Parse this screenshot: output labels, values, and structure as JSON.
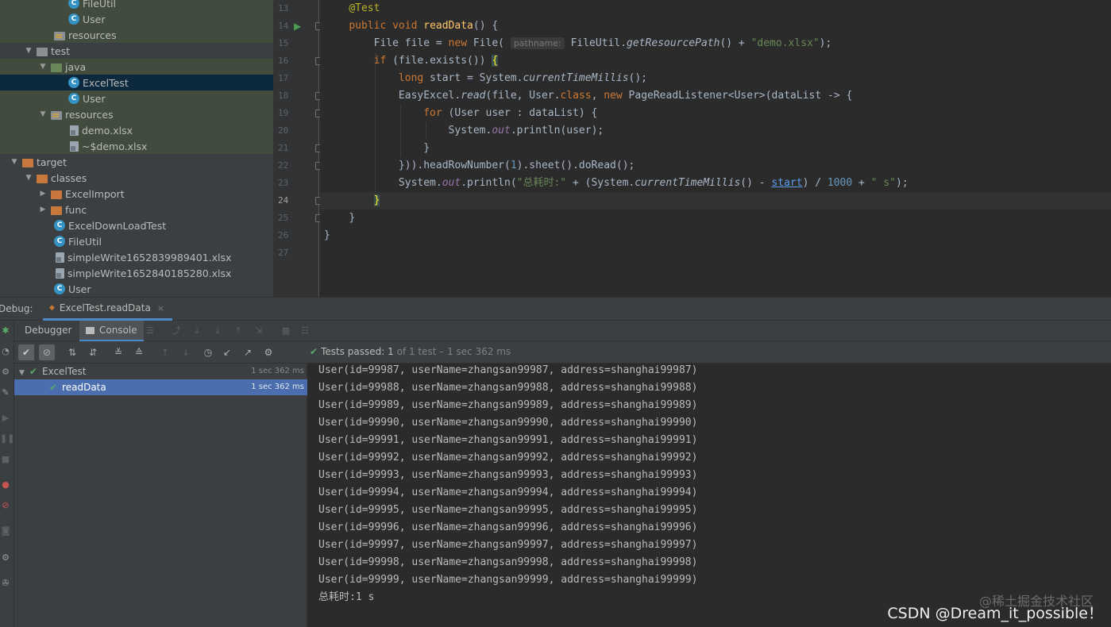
{
  "project_tree": {
    "items": [
      {
        "label": "FileUtil",
        "icon": "class-icon"
      },
      {
        "label": "User",
        "icon": "class-icon"
      },
      {
        "label": "resources",
        "icon": "resources-folder-icon"
      },
      {
        "label": "test",
        "icon": "folder-icon"
      },
      {
        "label": "java",
        "icon": "source-folder-icon"
      },
      {
        "label": "ExcelTest",
        "icon": "class-icon"
      },
      {
        "label": "User",
        "icon": "class-icon"
      },
      {
        "label": "resources",
        "icon": "resources-folder-icon"
      },
      {
        "label": "demo.xlsx",
        "icon": "file-icon"
      },
      {
        "label": "~$demo.xlsx",
        "icon": "file-icon"
      },
      {
        "label": "target",
        "icon": "folder-icon"
      },
      {
        "label": "classes",
        "icon": "folder-icon"
      },
      {
        "label": "ExcelImport",
        "icon": "folder-icon"
      },
      {
        "label": "func",
        "icon": "folder-icon"
      },
      {
        "label": "ExcelDownLoadTest",
        "icon": "class-icon"
      },
      {
        "label": "FileUtil",
        "icon": "class-icon"
      },
      {
        "label": "simpleWrite1652839989401.xlsx",
        "icon": "file-icon"
      },
      {
        "label": "simpleWrite1652840185280.xlsx",
        "icon": "file-icon"
      },
      {
        "label": "User",
        "icon": "class-icon"
      }
    ]
  },
  "editor": {
    "line_numbers": [
      "13",
      "14",
      "15",
      "16",
      "17",
      "18",
      "19",
      "20",
      "21",
      "22",
      "23",
      "24",
      "25",
      "26",
      "27"
    ],
    "current_line": "24",
    "param_hint": "pathname:",
    "code": {
      "l13_ann": "@Test",
      "l14_kw1": "public",
      "l14_kw2": "void",
      "l14_fn": "readData",
      "l14_rest": "() {",
      "l15_a": "File file = ",
      "l15_kw": "new",
      "l15_b": " File(",
      "l15_c": "FileUtil.",
      "l15_it": "getResourcePath",
      "l15_d": "() + ",
      "l15_str": "\"demo.xlsx\"",
      "l15_e": ");",
      "l16_kw": "if",
      "l16_a": " (file.exists()) ",
      "l16_brace": "{",
      "l17_kw": "long",
      "l17_a": " start = System.",
      "l17_it": "currentTimeMillis",
      "l17_b": "();",
      "l18_a": "EasyExcel.",
      "l18_it": "read",
      "l18_b": "(file, User.",
      "l18_kw1": "class",
      "l18_c": ", ",
      "l18_kw2": "new",
      "l18_d": " PageReadListener<User>(dataList -> {",
      "l19_kw": "for",
      "l19_a": " (User user : dataList) {",
      "l20_a": "System.",
      "l20_fld": "out",
      "l20_b": ".println(user);",
      "l21_a": "}",
      "l22_a": "})).headRowNumber(",
      "l22_num": "1",
      "l22_b": ").sheet().doRead();",
      "l23_a": "System.",
      "l23_fld": "out",
      "l23_b": ".println(",
      "l23_str1": "\"总耗时:\"",
      "l23_c": " + (System.",
      "l23_it": "currentTimeMillis",
      "l23_d": "() - ",
      "l23_und": "start",
      "l23_e": ") / ",
      "l23_num": "1000",
      "l23_f": " + ",
      "l23_str2": "\" s\"",
      "l23_g": ");",
      "l24_brace": "}",
      "l25_a": "}",
      "l26_a": "}"
    }
  },
  "debug_bar": {
    "label": "Debug:",
    "tab_label": "ExcelTest.readData",
    "close_glyph": "×"
  },
  "sub_tabs": {
    "debugger": "Debugger",
    "console": "Console"
  },
  "test_bar": {
    "passed_label": "Tests passed:",
    "passed_count": "1",
    "passed_detail": "of 1 test – 1 sec 362 ms"
  },
  "test_tree": {
    "rows": [
      {
        "label": "ExcelTest",
        "time": "1 sec 362 ms"
      },
      {
        "label": "readData",
        "time": "1 sec 362 ms"
      }
    ]
  },
  "console": {
    "lines": [
      "User(id=99987, userName=zhangsan99987, address=shanghai99987)",
      "User(id=99988, userName=zhangsan99988, address=shanghai99988)",
      "User(id=99989, userName=zhangsan99989, address=shanghai99989)",
      "User(id=99990, userName=zhangsan99990, address=shanghai99990)",
      "User(id=99991, userName=zhangsan99991, address=shanghai99991)",
      "User(id=99992, userName=zhangsan99992, address=shanghai99992)",
      "User(id=99993, userName=zhangsan99993, address=shanghai99993)",
      "User(id=99994, userName=zhangsan99994, address=shanghai99994)",
      "User(id=99995, userName=zhangsan99995, address=shanghai99995)",
      "User(id=99996, userName=zhangsan99996, address=shanghai99996)",
      "User(id=99997, userName=zhangsan99997, address=shanghai99997)",
      "User(id=99998, userName=zhangsan99998, address=shanghai99998)",
      "User(id=99999, userName=zhangsan99999, address=shanghai99999)",
      "总耗时:1 s"
    ],
    "watermark": "@稀土掘金技术社区",
    "credit": "CSDN @Dream_it_possible！"
  },
  "colors": {
    "accent": "#4a88c7",
    "pass_green": "#59a869",
    "selection": "#4b6eaf"
  }
}
